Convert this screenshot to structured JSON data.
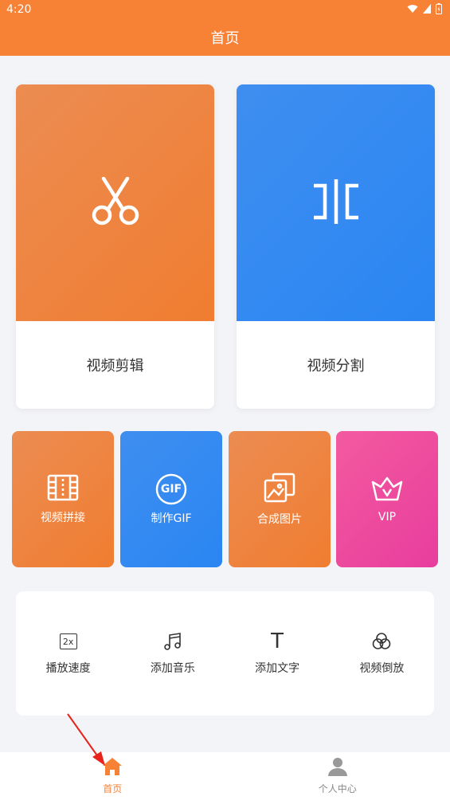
{
  "status_bar": {
    "time": "4:20"
  },
  "header": {
    "title": "首页"
  },
  "cards": {
    "edit": {
      "label": "视频剪辑",
      "icon": "scissors-icon"
    },
    "split": {
      "label": "视频分割",
      "icon": "split-icon"
    }
  },
  "tiles": [
    {
      "label": "视频拼接",
      "icon": "film-strip-icon"
    },
    {
      "label": "制作GIF",
      "icon": "gif-icon",
      "icon_text": "GIF"
    },
    {
      "label": "合成图片",
      "icon": "image-stack-icon"
    },
    {
      "label": "VIP",
      "icon": "crown-icon"
    }
  ],
  "tools": [
    {
      "label": "播放速度",
      "icon": "speed-icon",
      "icon_text": "2x"
    },
    {
      "label": "添加音乐",
      "icon": "music-note-icon"
    },
    {
      "label": "添加文字",
      "icon": "text-icon",
      "icon_text": "T"
    },
    {
      "label": "视频倒放",
      "icon": "reverse-icon"
    }
  ],
  "bottom_nav": [
    {
      "label": "首页",
      "icon": "home-icon",
      "active": true
    },
    {
      "label": "个人中心",
      "icon": "person-icon",
      "active": false
    }
  ],
  "colors": {
    "accent": "#f78236",
    "blue": "#2a86f2",
    "pink": "#e83d9e"
  }
}
